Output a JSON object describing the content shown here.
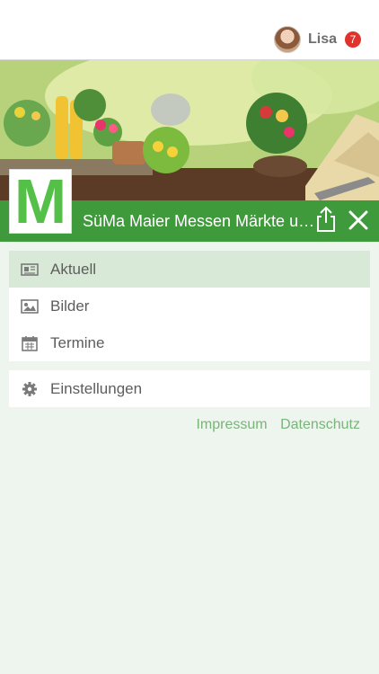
{
  "user": {
    "name": "Lisa",
    "notification_count": "7"
  },
  "app": {
    "logo_letter": "M",
    "title": "SüMa Maier Messen Märkte u…"
  },
  "menu": {
    "items": [
      {
        "label": "Aktuell",
        "icon": "newspaper-icon",
        "active": true
      },
      {
        "label": "Bilder",
        "icon": "image-icon",
        "active": false
      },
      {
        "label": "Termine",
        "icon": "calendar-icon",
        "active": false
      }
    ],
    "settings": {
      "label": "Einstellungen",
      "icon": "gear-icon"
    }
  },
  "footer": {
    "impressum": "Impressum",
    "datenschutz": "Datenschutz"
  },
  "colors": {
    "brand_green": "#3f9a3b",
    "logo_green": "#55c048",
    "active_bg": "#d8ead7",
    "badge_red": "#e0332c",
    "link_green": "#79b479"
  }
}
